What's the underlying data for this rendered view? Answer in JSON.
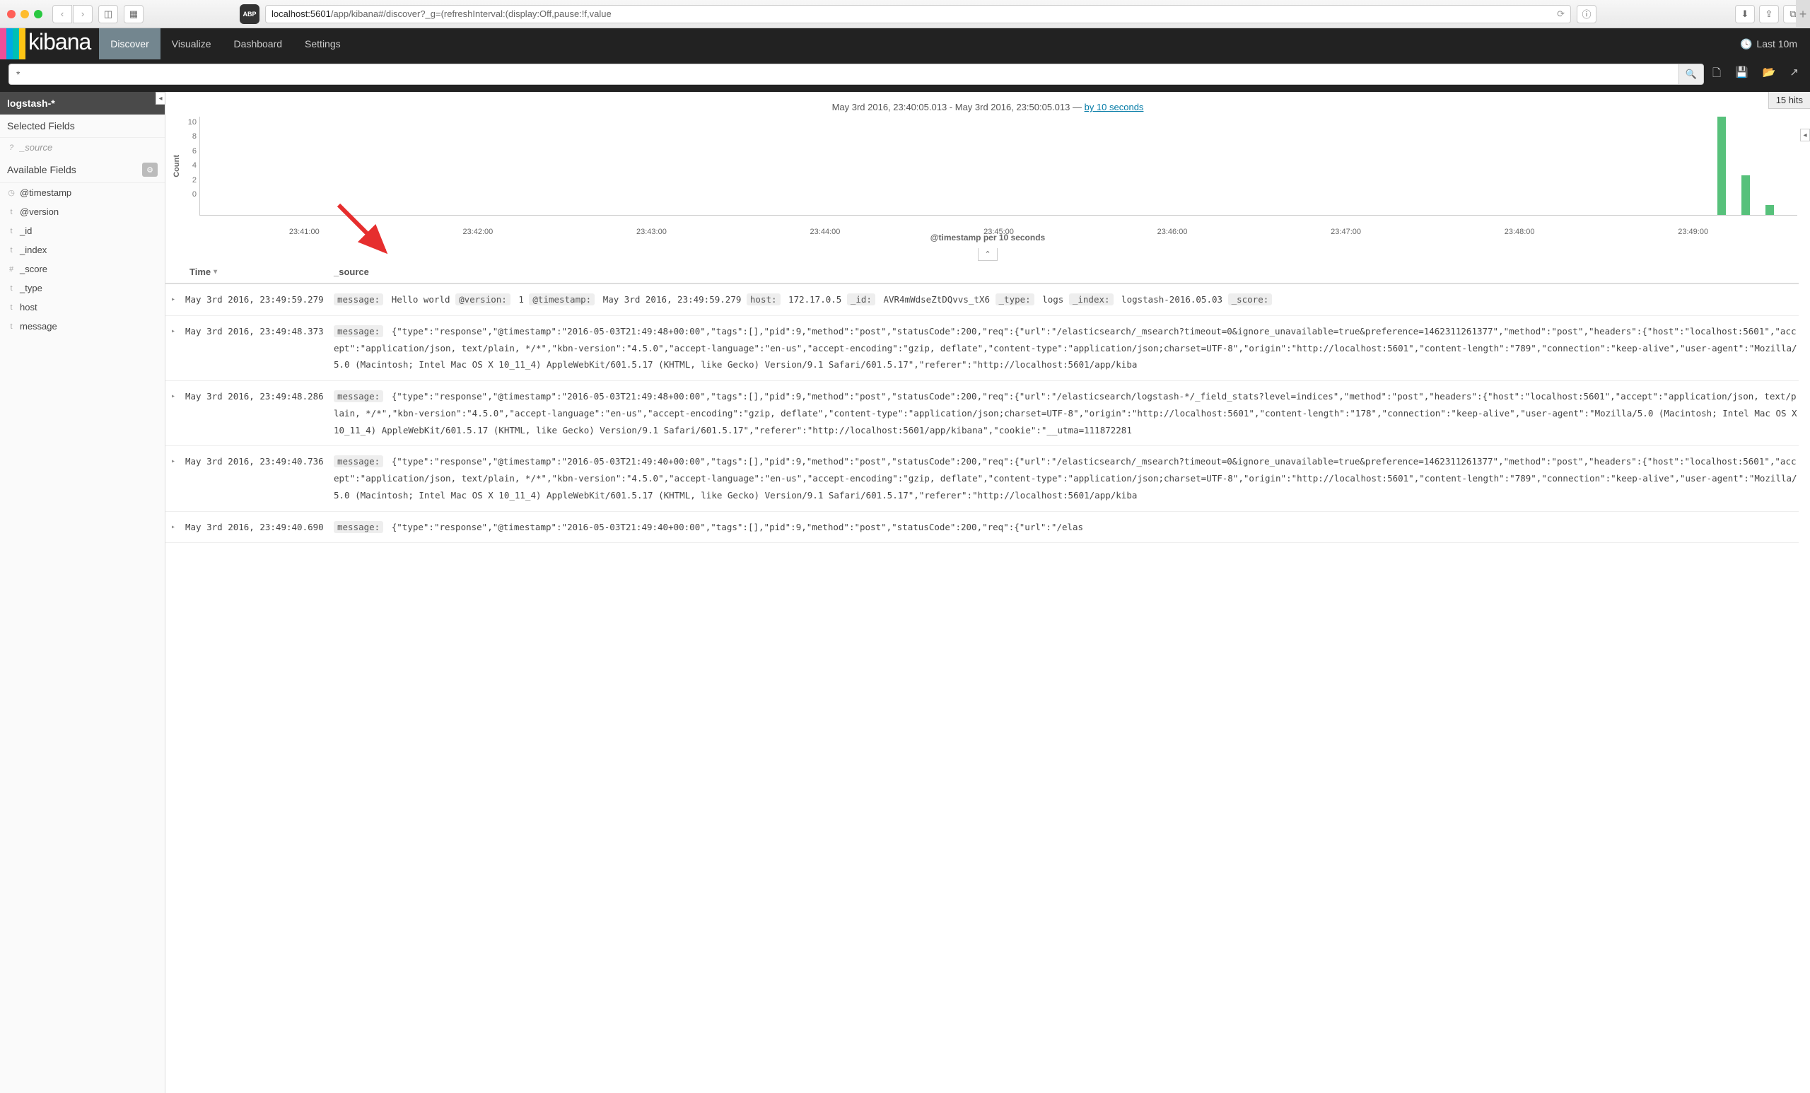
{
  "browser": {
    "url_host": "localhost:5601",
    "url_path": "/app/kibana#/discover?_g=(refreshInterval:(display:Off,pause:!f,value",
    "abp_label": "ABP",
    "new_tab": "+"
  },
  "header": {
    "logo": "kibana",
    "nav": [
      "Discover",
      "Visualize",
      "Dashboard",
      "Settings"
    ],
    "active": 0,
    "time_label": "Last 10m"
  },
  "search": {
    "query": "*"
  },
  "sidebar": {
    "index_pattern": "logstash-*",
    "selected_label": "Selected Fields",
    "source_field": "_source",
    "available_label": "Available Fields",
    "fields": [
      {
        "icon": "◷",
        "name": "@timestamp"
      },
      {
        "icon": "t",
        "name": "@version"
      },
      {
        "icon": "t",
        "name": "_id"
      },
      {
        "icon": "t",
        "name": "_index"
      },
      {
        "icon": "#",
        "name": "_score"
      },
      {
        "icon": "t",
        "name": "_type"
      },
      {
        "icon": "t",
        "name": "host"
      },
      {
        "icon": "t",
        "name": "message"
      }
    ]
  },
  "hits": "15 hits",
  "chart_title": {
    "range": "May 3rd 2016, 23:40:05.013 - May 3rd 2016, 23:50:05.013",
    "sep": " — ",
    "interval": "by 10 seconds"
  },
  "chart_data": {
    "type": "bar",
    "ylabel": "Count",
    "xlabel": "@timestamp per 10 seconds",
    "ylim": [
      0,
      10
    ],
    "yticks": [
      10,
      8,
      6,
      4,
      2,
      0
    ],
    "xticks": [
      "23:41:00",
      "23:42:00",
      "23:43:00",
      "23:44:00",
      "23:45:00",
      "23:46:00",
      "23:47:00",
      "23:48:00",
      "23:49:00"
    ],
    "bars": [
      {
        "x_pct": 95.0,
        "value": 10
      },
      {
        "x_pct": 96.5,
        "value": 4
      },
      {
        "x_pct": 98.0,
        "value": 1
      }
    ]
  },
  "table": {
    "col_time": "Time",
    "col_source": "_source",
    "rows": [
      {
        "time": "May 3rd 2016, 23:49:59.279",
        "fields": [
          {
            "k": "message:",
            "v": "Hello world"
          },
          {
            "k": "@version:",
            "v": "1"
          },
          {
            "k": "@timestamp:",
            "v": "May 3rd 2016, 23:49:59.279"
          },
          {
            "k": "host:",
            "v": "172.17.0.5"
          },
          {
            "k": "_id:",
            "v": "AVR4mWdseZtDQvvs_tX6"
          },
          {
            "k": "_type:",
            "v": "logs"
          },
          {
            "k": "_index:",
            "v": "logstash-2016.05.03"
          },
          {
            "k": "_score:",
            "v": ""
          }
        ]
      },
      {
        "time": "May 3rd 2016, 23:49:48.373",
        "fields": [
          {
            "k": "message:",
            "v": "{\"type\":\"response\",\"@timestamp\":\"2016-05-03T21:49:48+00:00\",\"tags\":[],\"pid\":9,\"method\":\"post\",\"statusCode\":200,\"req\":{\"url\":\"/elasticsearch/_msearch?timeout=0&ignore_unavailable=true&preference=1462311261377\",\"method\":\"post\",\"headers\":{\"host\":\"localhost:5601\",\"accept\":\"application/json, text/plain, */*\",\"kbn-version\":\"4.5.0\",\"accept-language\":\"en-us\",\"accept-encoding\":\"gzip, deflate\",\"content-type\":\"application/json;charset=UTF-8\",\"origin\":\"http://localhost:5601\",\"content-length\":\"789\",\"connection\":\"keep-alive\",\"user-agent\":\"Mozilla/5.0 (Macintosh; Intel Mac OS X 10_11_4) AppleWebKit/601.5.17 (KHTML, like Gecko) Version/9.1 Safari/601.5.17\",\"referer\":\"http://localhost:5601/app/kiba"
          }
        ]
      },
      {
        "time": "May 3rd 2016, 23:49:48.286",
        "fields": [
          {
            "k": "message:",
            "v": "{\"type\":\"response\",\"@timestamp\":\"2016-05-03T21:49:48+00:00\",\"tags\":[],\"pid\":9,\"method\":\"post\",\"statusCode\":200,\"req\":{\"url\":\"/elasticsearch/logstash-*/_field_stats?level=indices\",\"method\":\"post\",\"headers\":{\"host\":\"localhost:5601\",\"accept\":\"application/json, text/plain, */*\",\"kbn-version\":\"4.5.0\",\"accept-language\":\"en-us\",\"accept-encoding\":\"gzip, deflate\",\"content-type\":\"application/json;charset=UTF-8\",\"origin\":\"http://localhost:5601\",\"content-length\":\"178\",\"connection\":\"keep-alive\",\"user-agent\":\"Mozilla/5.0 (Macintosh; Intel Mac OS X 10_11_4) AppleWebKit/601.5.17 (KHTML, like Gecko) Version/9.1 Safari/601.5.17\",\"referer\":\"http://localhost:5601/app/kibana\",\"cookie\":\"__utma=111872281"
          }
        ]
      },
      {
        "time": "May 3rd 2016, 23:49:40.736",
        "fields": [
          {
            "k": "message:",
            "v": "{\"type\":\"response\",\"@timestamp\":\"2016-05-03T21:49:40+00:00\",\"tags\":[],\"pid\":9,\"method\":\"post\",\"statusCode\":200,\"req\":{\"url\":\"/elasticsearch/_msearch?timeout=0&ignore_unavailable=true&preference=1462311261377\",\"method\":\"post\",\"headers\":{\"host\":\"localhost:5601\",\"accept\":\"application/json, text/plain, */*\",\"kbn-version\":\"4.5.0\",\"accept-language\":\"en-us\",\"accept-encoding\":\"gzip, deflate\",\"content-type\":\"application/json;charset=UTF-8\",\"origin\":\"http://localhost:5601\",\"content-length\":\"789\",\"connection\":\"keep-alive\",\"user-agent\":\"Mozilla/5.0 (Macintosh; Intel Mac OS X 10_11_4) AppleWebKit/601.5.17 (KHTML, like Gecko) Version/9.1 Safari/601.5.17\",\"referer\":\"http://localhost:5601/app/kiba"
          }
        ]
      },
      {
        "time": "May 3rd 2016, 23:49:40.690",
        "fields": [
          {
            "k": "message:",
            "v": "{\"type\":\"response\",\"@timestamp\":\"2016-05-03T21:49:40+00:00\",\"tags\":[],\"pid\":9,\"method\":\"post\",\"statusCode\":200,\"req\":{\"url\":\"/elas"
          }
        ]
      }
    ]
  }
}
